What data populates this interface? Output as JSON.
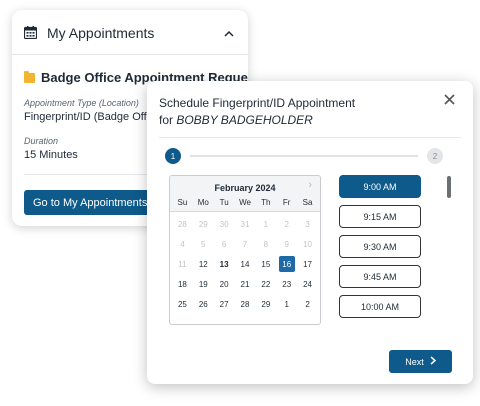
{
  "appointments_card": {
    "title": "My Appointments",
    "chevron": "^",
    "appointment_title": "Badge Office Appointment Request",
    "type_label": "Appointment Type (Location)",
    "type_value": "Fingerprint/ID (Badge Office)",
    "duration_label": "Duration",
    "duration_value": "15 Minutes",
    "button_label": "Go to My Appointments"
  },
  "modal": {
    "title_line1": "Schedule Fingerprint/ID Appointment",
    "title_for": "for ",
    "title_name": "BOBBY BADGEHOLDER",
    "close": "✕",
    "steps": [
      "1",
      "2"
    ],
    "next_label": "Next",
    "next_chevron": "›"
  },
  "calendar": {
    "month": "February 2024",
    "next_arrow": "›",
    "weekdays": [
      "Su",
      "Mo",
      "Tu",
      "We",
      "Th",
      "Fr",
      "Sa"
    ],
    "days": [
      {
        "d": "28",
        "s": "muted"
      },
      {
        "d": "29",
        "s": "muted"
      },
      {
        "d": "30",
        "s": "muted"
      },
      {
        "d": "31",
        "s": "muted"
      },
      {
        "d": "1",
        "s": "muted"
      },
      {
        "d": "2",
        "s": "muted"
      },
      {
        "d": "3",
        "s": "muted"
      },
      {
        "d": "4",
        "s": "muted"
      },
      {
        "d": "5",
        "s": "muted"
      },
      {
        "d": "6",
        "s": "muted"
      },
      {
        "d": "7",
        "s": "muted"
      },
      {
        "d": "8",
        "s": "muted"
      },
      {
        "d": "9",
        "s": "muted"
      },
      {
        "d": "10",
        "s": "muted"
      },
      {
        "d": "11",
        "s": "muted"
      },
      {
        "d": "12",
        "s": ""
      },
      {
        "d": "13",
        "s": "bold"
      },
      {
        "d": "14",
        "s": ""
      },
      {
        "d": "15",
        "s": ""
      },
      {
        "d": "16",
        "s": "selected"
      },
      {
        "d": "17",
        "s": ""
      },
      {
        "d": "18",
        "s": ""
      },
      {
        "d": "19",
        "s": ""
      },
      {
        "d": "20",
        "s": ""
      },
      {
        "d": "21",
        "s": ""
      },
      {
        "d": "22",
        "s": ""
      },
      {
        "d": "23",
        "s": ""
      },
      {
        "d": "24",
        "s": ""
      },
      {
        "d": "25",
        "s": ""
      },
      {
        "d": "26",
        "s": ""
      },
      {
        "d": "27",
        "s": ""
      },
      {
        "d": "28",
        "s": ""
      },
      {
        "d": "29",
        "s": ""
      },
      {
        "d": "1",
        "s": ""
      },
      {
        "d": "2",
        "s": ""
      }
    ]
  },
  "time_slots": [
    {
      "label": "9:00 AM",
      "active": true
    },
    {
      "label": "9:15 AM",
      "active": false
    },
    {
      "label": "9:30 AM",
      "active": false
    },
    {
      "label": "9:45 AM",
      "active": false
    },
    {
      "label": "10:00 AM",
      "active": false
    }
  ],
  "colors": {
    "primary": "#0e5a8a",
    "selected_day": "#1d6aa6",
    "folder": "#f2b531"
  }
}
